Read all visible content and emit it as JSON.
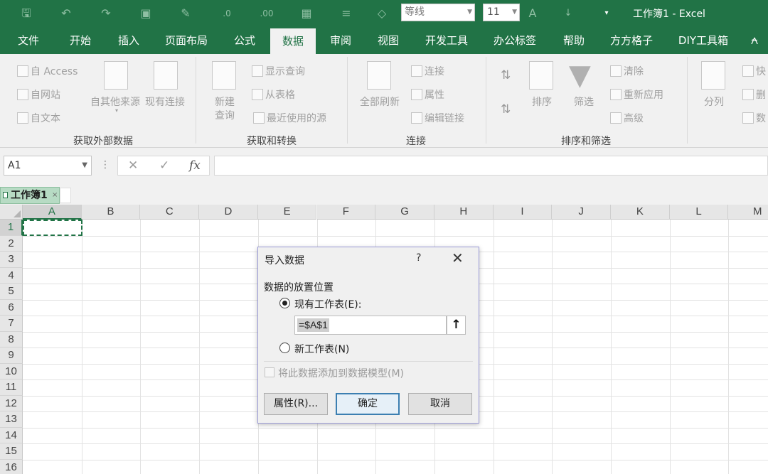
{
  "window": {
    "title": "工作簿1  -  Excel"
  },
  "qat": {
    "font_name": "等线",
    "font_size": "11",
    "icons": [
      "save-icon",
      "undo-icon",
      "redo-icon",
      "camera-icon",
      "format-painter-icon",
      "decrease-decimal-icon",
      "increase-decimal-icon",
      "table-icon",
      "align-icon",
      "paint-bucket-icon",
      "font-color-icon",
      "sort-icon",
      "customize-qat-icon"
    ]
  },
  "tabs": [
    "文件",
    "开始",
    "插入",
    "页面布局",
    "公式",
    "数据",
    "审阅",
    "视图",
    "开发工具",
    "办公标签",
    "帮助",
    "方方格子",
    "DIY工具箱"
  ],
  "active_tab": "数据",
  "ribbon": {
    "get_external": {
      "label": "获取外部数据",
      "from_access": "自 Access",
      "from_web": "自网站",
      "from_text": "自文本",
      "from_other": "自其他来源",
      "existing": "现有连接"
    },
    "get_transform": {
      "label": "获取和转换",
      "new_query_1": "新建",
      "new_query_2": "查询",
      "show_queries": "显示查询",
      "from_table": "从表格",
      "recent_sources": "最近使用的源"
    },
    "connections": {
      "label": "连接",
      "refresh_all": "全部刷新",
      "connections": "连接",
      "properties": "属性",
      "edit_links": "编辑链接"
    },
    "sort_filter": {
      "label": "排序和筛选",
      "sort": "排序",
      "filter": "筛选",
      "clear": "清除",
      "reapply": "重新应用",
      "advanced": "高级"
    },
    "data_tools": {
      "text_to_columns": "分列",
      "flash_fill": "快",
      "remove_dup": "删",
      "validate": "数"
    }
  },
  "formula_bar": {
    "name_box": "A1",
    "cancel": "✕",
    "enter": "✓",
    "fx": "fx",
    "formula": ""
  },
  "workbook_tab": {
    "name": "工作簿1",
    "close": "×"
  },
  "grid": {
    "columns": [
      "A",
      "B",
      "C",
      "D",
      "E",
      "F",
      "G",
      "H",
      "I",
      "J",
      "K",
      "L",
      "M"
    ],
    "rows": [
      "1",
      "2",
      "3",
      "4",
      "5",
      "6",
      "7",
      "8",
      "9",
      "10",
      "11",
      "12",
      "13",
      "14",
      "15",
      "16"
    ],
    "selected_cell": "A1"
  },
  "dialog": {
    "title": "导入数据",
    "help": "?",
    "close": "✕",
    "section": "数据的放置位置",
    "option_existing": "现有工作表(E):",
    "reference": "=$A$1",
    "option_new": "新工作表(N)",
    "add_to_model": "将此数据添加到数据模型(M)",
    "btn_properties": "属性(R)...",
    "btn_ok": "确定",
    "btn_cancel": "取消",
    "selected_option": "existing"
  }
}
